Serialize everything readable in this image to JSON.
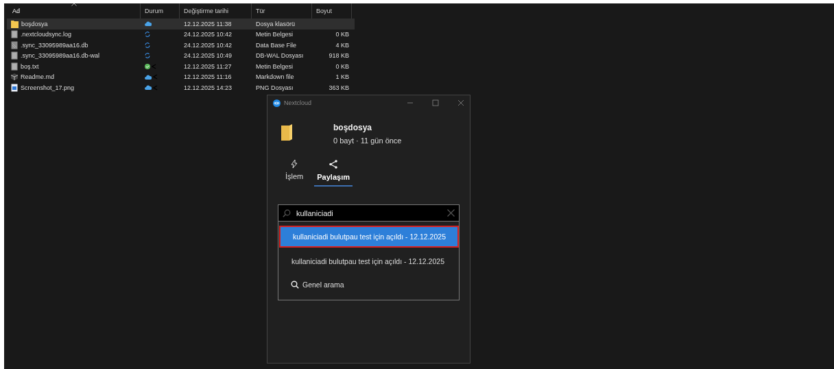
{
  "explorer": {
    "columns": [
      {
        "label": "Ad",
        "sorted": true
      },
      {
        "label": "Durum",
        "sorted": false
      },
      {
        "label": "Değiştirme tarihi",
        "sorted": false
      },
      {
        "label": "Tür",
        "sorted": false
      },
      {
        "label": "Boyut",
        "sorted": false
      }
    ],
    "rows": [
      {
        "name": "boşdosya",
        "kind": "folder",
        "status": {
          "kind": "cloud",
          "shared": false
        },
        "modified": "12.12.2025 11:38",
        "type": "Dosya klasörü",
        "selected": true
      },
      {
        "name": ".nextcloudsync.log",
        "kind": "text",
        "status": {
          "kind": "sync",
          "shared": false
        },
        "modified": "24.12.2025 10:42",
        "type": "Metin Belgesi",
        "size": "0 KB",
        "selected": false
      },
      {
        "name": ".sync_33095989aa16.db",
        "kind": "data",
        "status": {
          "kind": "sync",
          "shared": false
        },
        "modified": "24.12.2025 10:42",
        "type": "Data Base File",
        "size": "4 KB",
        "selected": false
      },
      {
        "name": ".sync_33095989aa16.db-wal",
        "kind": "text",
        "status": {
          "kind": "sync",
          "shared": false
        },
        "modified": "24.12.2025 10:49",
        "type": "DB-WAL Dosyası",
        "size": "918 KB",
        "selected": false
      },
      {
        "name": "boş.txt",
        "kind": "text",
        "status": {
          "kind": "check",
          "shared": true
        },
        "modified": "12.12.2025 11:27",
        "type": "Metin Belgesi",
        "size": "0 KB",
        "selected": false
      },
      {
        "name": "Readme.md",
        "kind": "markdown",
        "status": {
          "kind": "cloud",
          "shared": true
        },
        "modified": "12.12.2025 11:16",
        "type": "Markdown file",
        "size": "1 KB",
        "selected": false
      },
      {
        "name": "Screenshot_17.png",
        "kind": "image",
        "status": {
          "kind": "cloud",
          "shared": true
        },
        "modified": "12.12.2025 14:23",
        "type": "PNG Dosyası",
        "size": "363 KB",
        "selected": false
      }
    ]
  },
  "dialog": {
    "title": "Nextcloud",
    "file_name": "boşdosya",
    "file_info": "0 bayt · 11 gün önce",
    "tabs": [
      {
        "label": "İşlem",
        "selected": false
      },
      {
        "label": "Paylaşım",
        "selected": true
      }
    ],
    "search": {
      "value": "kullaniciadi"
    },
    "results": [
      {
        "kind": "result",
        "label": "kullaniciadi bulutpau test için açıldı - 12.12.2025",
        "selected": true,
        "highlighted": true
      },
      {
        "kind": "result",
        "label": "kullaniciadi bulutpau test için açıldı - 12.12.2025",
        "selected": false,
        "highlighted": false
      },
      {
        "kind": "global",
        "label": "Genel arama",
        "selected": false,
        "highlighted": false
      }
    ]
  }
}
